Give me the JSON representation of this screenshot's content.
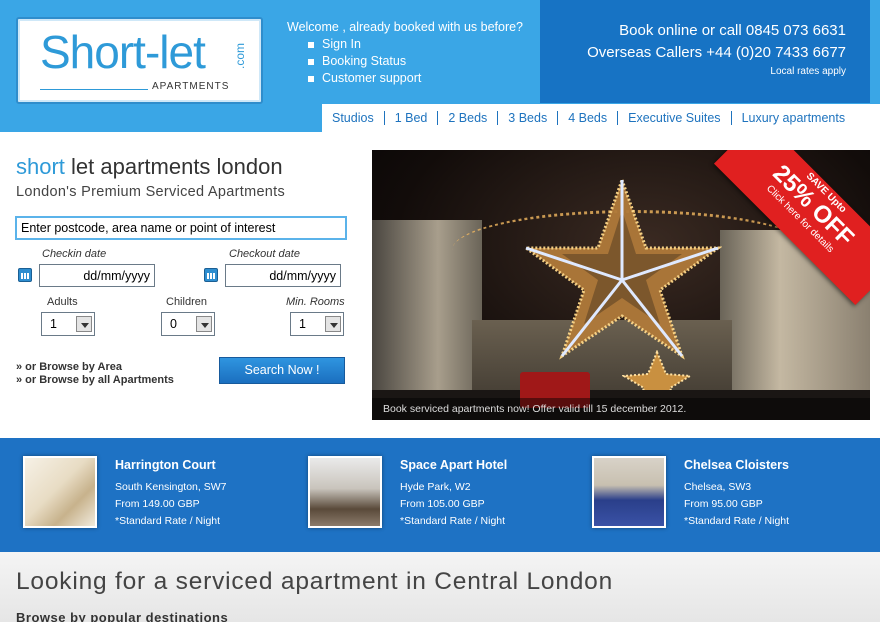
{
  "brand": {
    "logo_word": "Short-let",
    "logo_com": ".com",
    "logo_sub": "APARTMENTS"
  },
  "welcome": {
    "text": "Welcome , already booked with us before?",
    "links": [
      "Sign In",
      "Booking Status",
      "Customer support"
    ]
  },
  "contact": {
    "line1": "Book online or call  0845 073 6631",
    "line2": "Overseas Callers  +44 (0)20 7433 6677",
    "note": "Local rates apply"
  },
  "nav": [
    "Studios",
    "1 Bed",
    "2 Beds",
    "3 Beds",
    "4 Beds",
    "Executive Suites",
    "Luxury apartments"
  ],
  "search": {
    "title_highlight": "short",
    "title_rest": " let apartments london",
    "subtitle": "London's Premium Serviced Apartments",
    "destination_value": "Enter postcode, area name or point of interest",
    "checkin_label": "Checkin date",
    "checkout_label": "Checkout date",
    "checkin_value": "dd/mm/yyyy",
    "checkout_value": "dd/mm/yyyy",
    "adults_label": "Adults",
    "children_label": "Children",
    "rooms_label": "Min. Rooms",
    "adults_value": "1",
    "children_value": "0",
    "rooms_value": "1",
    "browse_area": "» or Browse by Area",
    "browse_all": "» or Browse by all Apartments",
    "button": "Search Now !"
  },
  "hero": {
    "caption": "Book serviced apartments now! Offer valid till 15 december 2012.",
    "ribbon_top": "SAVE Upto",
    "ribbon_pct": "25% OFF",
    "ribbon_bottom": "Click here for details"
  },
  "featured": [
    {
      "name": "Harrington Court",
      "location": "South Kensington, SW7",
      "price": "From 149.00 GBP",
      "rate": "*Standard Rate / Night"
    },
    {
      "name": "Space Apart Hotel",
      "location": "Hyde Park, W2",
      "price": "From 105.00 GBP",
      "rate": "*Standard Rate / Night"
    },
    {
      "name": "Chelsea Cloisters",
      "location": "Chelsea, SW3",
      "price": "From 95.00 GBP",
      "rate": "*Standard Rate / Night"
    }
  ],
  "bottom": {
    "title": "Looking for a serviced apartment in Central London",
    "subtitle": "Browse by popular destinations"
  },
  "colors": {
    "header_blue": "#3aa6e6",
    "dark_blue": "#1773c4",
    "featured_blue": "#1e72c4",
    "accent_red": "#e02020"
  }
}
